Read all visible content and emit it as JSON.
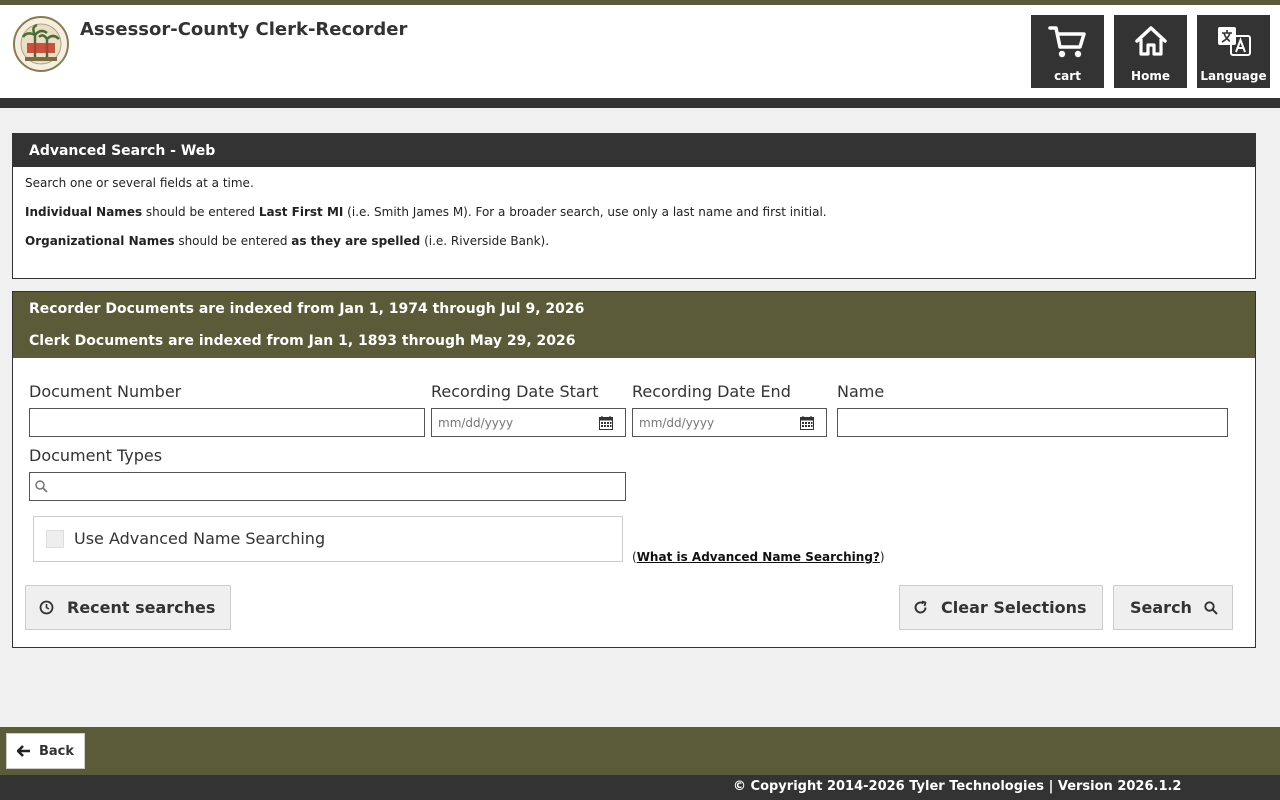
{
  "header": {
    "title": "Assessor-County Clerk-Recorder",
    "buttons": [
      {
        "label": "cart",
        "icon": "cart-icon"
      },
      {
        "label": "Home",
        "icon": "home-icon"
      },
      {
        "label": "Language",
        "icon": "translate-icon"
      }
    ]
  },
  "info_panel": {
    "title": "Advanced Search - Web",
    "line1": "Search one or several fields at a time.",
    "line2": {
      "b1": "Individual Names",
      "t1": " should be entered ",
      "b2": "Last First MI",
      "t2": " (i.e. Smith James M). For a broader search, use only a last name and first initial."
    },
    "line3": {
      "b1": "Organizational Names",
      "t1": " should be entered ",
      "b2": "as they are spelled",
      "t2": " (i.e. Riverside Bank)."
    }
  },
  "search_panel": {
    "index_lines": [
      "Recorder Documents are indexed from Jan 1, 1974 through Jul 9, 2026",
      "Clerk Documents are indexed from Jan 1, 1893 through May 29, 2026"
    ],
    "fields": {
      "document_number": {
        "label": "Document Number",
        "value": "",
        "placeholder": ""
      },
      "recording_date_start": {
        "label": "Recording Date Start",
        "value": "",
        "placeholder": "mm/dd/yyyy"
      },
      "recording_date_end": {
        "label": "Recording Date End",
        "value": "",
        "placeholder": "mm/dd/yyyy"
      },
      "name": {
        "label": "Name",
        "value": "",
        "placeholder": ""
      },
      "document_types": {
        "label": "Document Types",
        "value": "",
        "placeholder": ""
      }
    },
    "advanced_name": {
      "label": "Use Advanced Name Searching",
      "checked": false,
      "help_open": "(",
      "help_link": "What is Advanced Name Searching?",
      "help_close": ")"
    },
    "buttons": {
      "recent": "Recent searches",
      "clear": "Clear Selections",
      "search": "Search"
    }
  },
  "footer": {
    "back_label": "Back",
    "copyright": "© Copyright 2014-2026 Tyler Technologies | Version 2026.1.2"
  },
  "colors": {
    "olive": "#5b5a39",
    "dark": "#333333",
    "button_bg": "#efefef"
  }
}
